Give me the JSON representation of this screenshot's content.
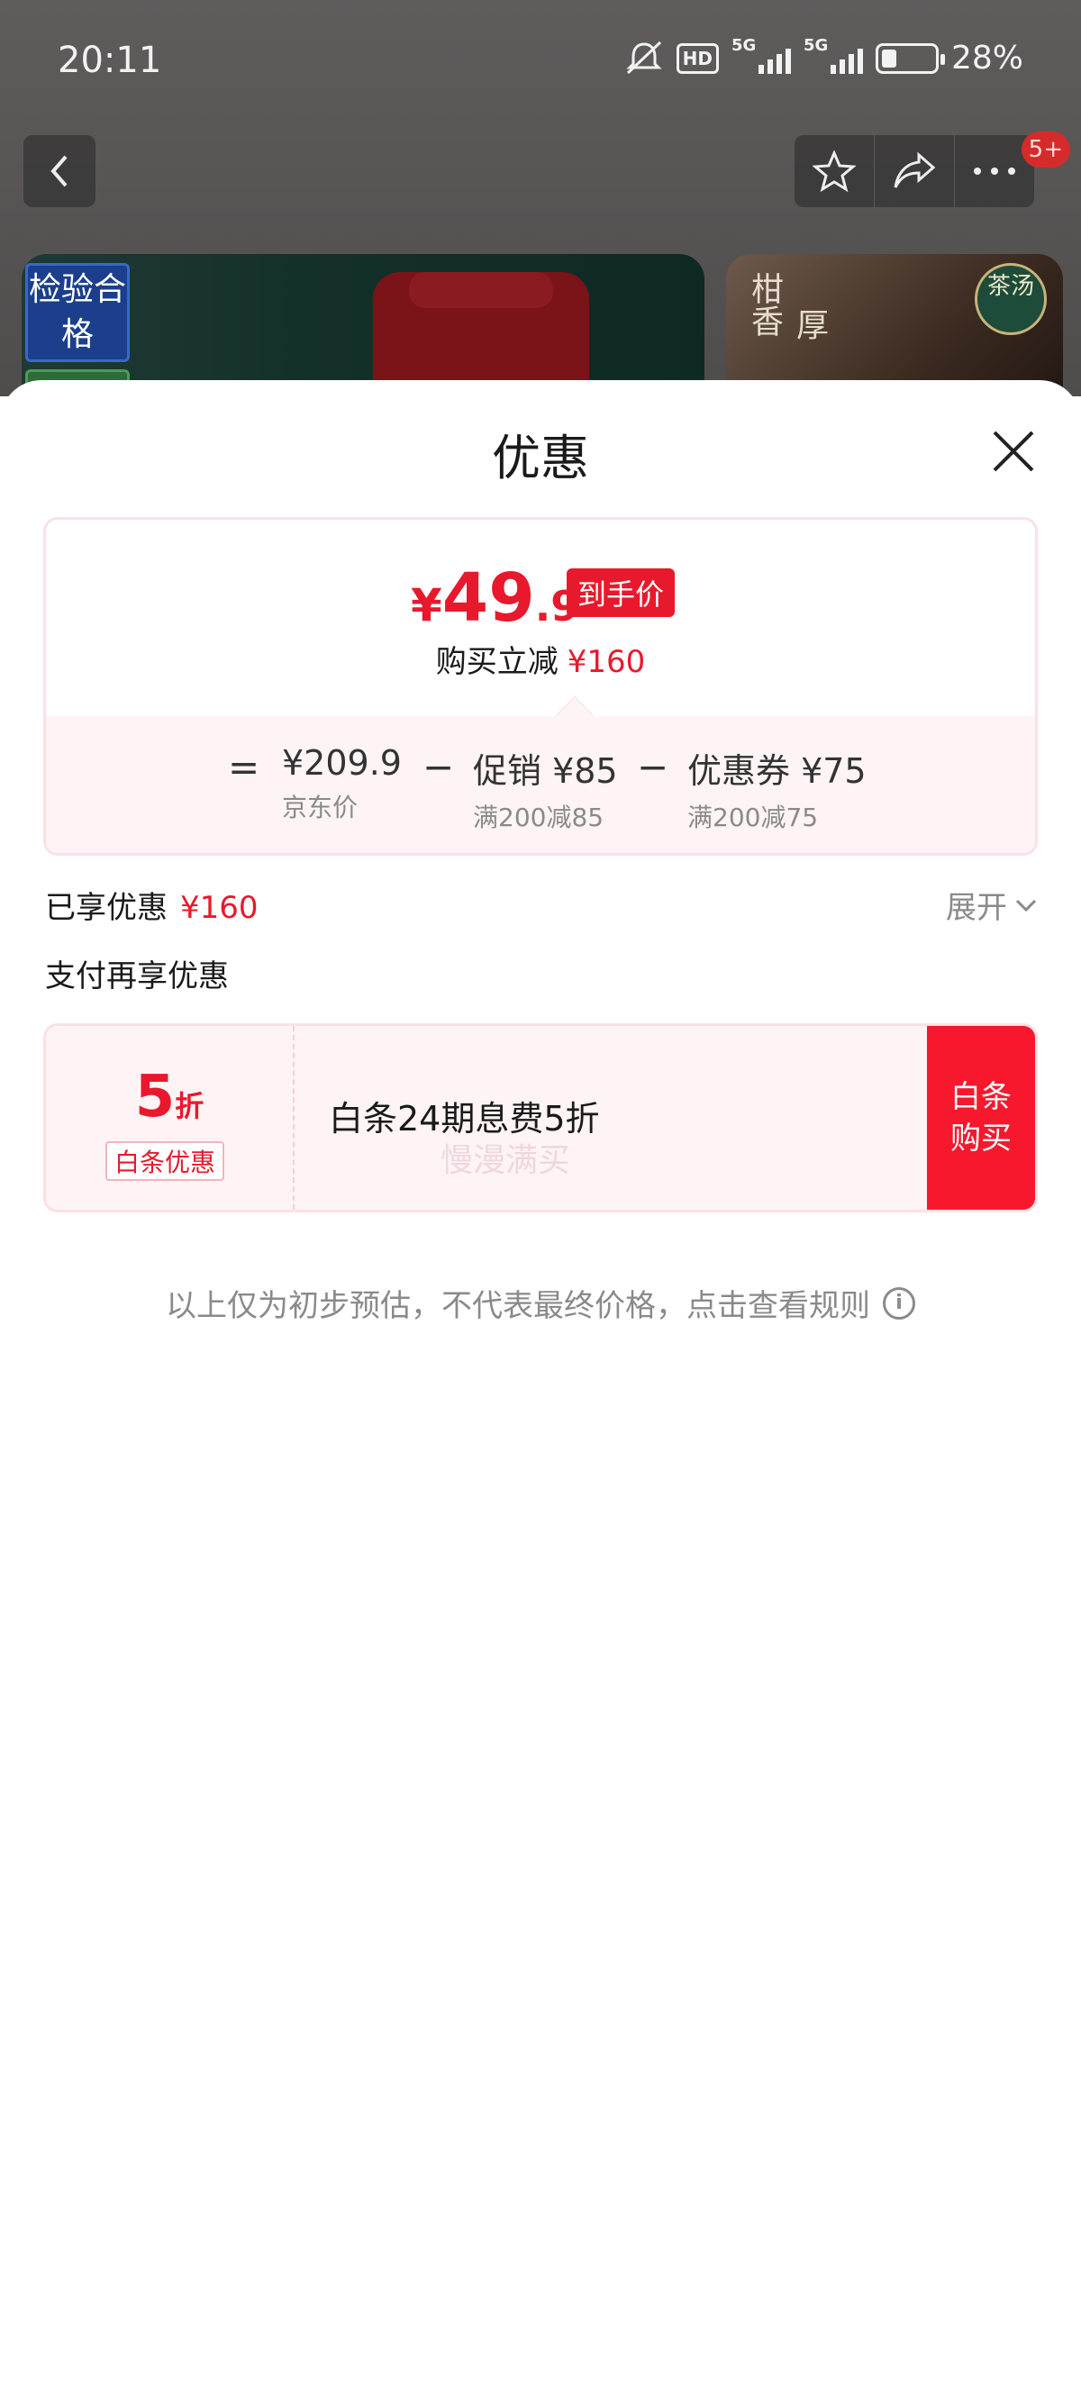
{
  "status_bar": {
    "time": "20:11",
    "hd_label": "HD",
    "net1": "5G",
    "net2": "5G",
    "battery": "28%"
  },
  "nav": {
    "badge": "5+"
  },
  "background_images": {
    "left_badge": "检验合格",
    "right_text_1": "柑香",
    "right_text_2": "厚",
    "right_seal": "茶汤"
  },
  "sheet": {
    "title": "优惠",
    "price": {
      "currency": "¥",
      "integer": "49",
      "decimal": ".9",
      "tag": "到手价"
    },
    "instant_reduce": {
      "label": "购买立减",
      "amount": "¥160"
    },
    "formula": {
      "equals": "=",
      "minus": "−",
      "jd_price": {
        "value": "¥209.9",
        "label": "京东价"
      },
      "promotion": {
        "value": "促销 ¥85",
        "label": "满200减85"
      },
      "coupon": {
        "value": "优惠券 ¥75",
        "label": "满200减75"
      }
    },
    "enjoyed": {
      "label": "已享优惠",
      "amount": "¥160"
    },
    "expand_label": "展开",
    "pay_title": "支付再享优惠",
    "baitiao": {
      "discount_num": "5",
      "discount_unit": "折",
      "tag": "白条优惠",
      "description": "白条24期息费5折",
      "watermark": "慢漫满买",
      "button": "白条购买"
    },
    "disclaimer": "以上仅为初步预估，不代表最终价格，点击查看规则"
  },
  "colors": {
    "accent": "#e8192c",
    "button": "#f7182e",
    "card_bg": "#fef4f5",
    "card_border": "#fbe1e4"
  },
  "icons": [
    "back-icon",
    "star-icon",
    "share-icon",
    "more-icon",
    "close-icon",
    "chevron-down-icon",
    "info-icon"
  ]
}
